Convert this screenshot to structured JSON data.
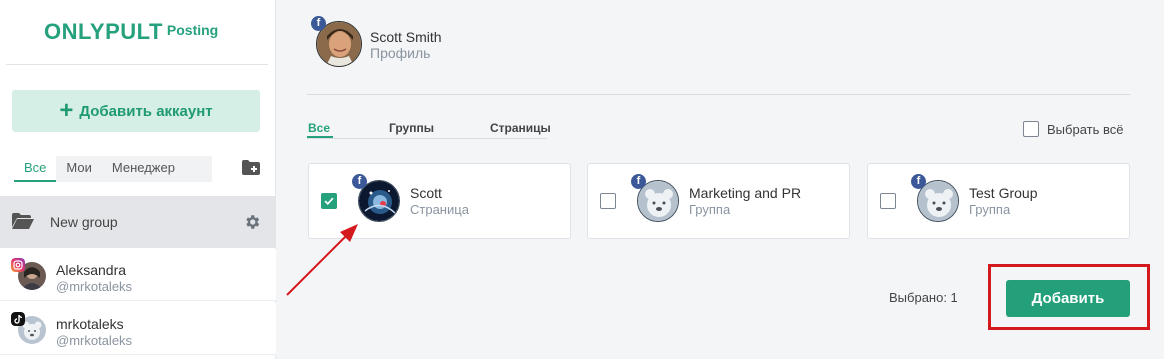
{
  "brand": {
    "name": "ONLYPULT",
    "product": "Posting",
    "color": "#26a17e"
  },
  "sidebar": {
    "add_account_label": "Добавить аккаунт",
    "filter_tabs": [
      {
        "label": "Все",
        "active": true
      },
      {
        "label": "Мои",
        "active": false
      },
      {
        "label": "Менеджер",
        "active": false
      }
    ],
    "add_folder_icon": "folder-plus-icon",
    "group": {
      "name": "New group",
      "icon": "folder-open-icon",
      "settings_icon": "gear-icon"
    },
    "accounts": [
      {
        "name": "Aleksandra",
        "handle": "@mrkotaleks",
        "network": "instagram"
      },
      {
        "name": "mrkotaleks",
        "handle": "@mrkotaleks",
        "network": "tiktok"
      }
    ]
  },
  "main": {
    "profile": {
      "name": "Scott Smith",
      "type": "Профиль",
      "network": "facebook"
    },
    "tabs": [
      {
        "label": "Все",
        "active": true
      },
      {
        "label": "Группы",
        "active": false
      },
      {
        "label": "Страницы",
        "active": false
      }
    ],
    "select_all_label": "Выбрать всё",
    "cards": [
      {
        "name": "Scott",
        "type": "Страница",
        "checked": true,
        "network": "facebook"
      },
      {
        "name": "Marketing and PR",
        "type": "Группа",
        "checked": false,
        "network": "facebook"
      },
      {
        "name": "Test Group",
        "type": "Группа",
        "checked": false,
        "network": "facebook"
      }
    ],
    "fb_badge": "f",
    "selected_text": "Выбрано: 1",
    "submit_label": "Добавить"
  },
  "annotations": {
    "highlight_color": "#d4191e"
  }
}
